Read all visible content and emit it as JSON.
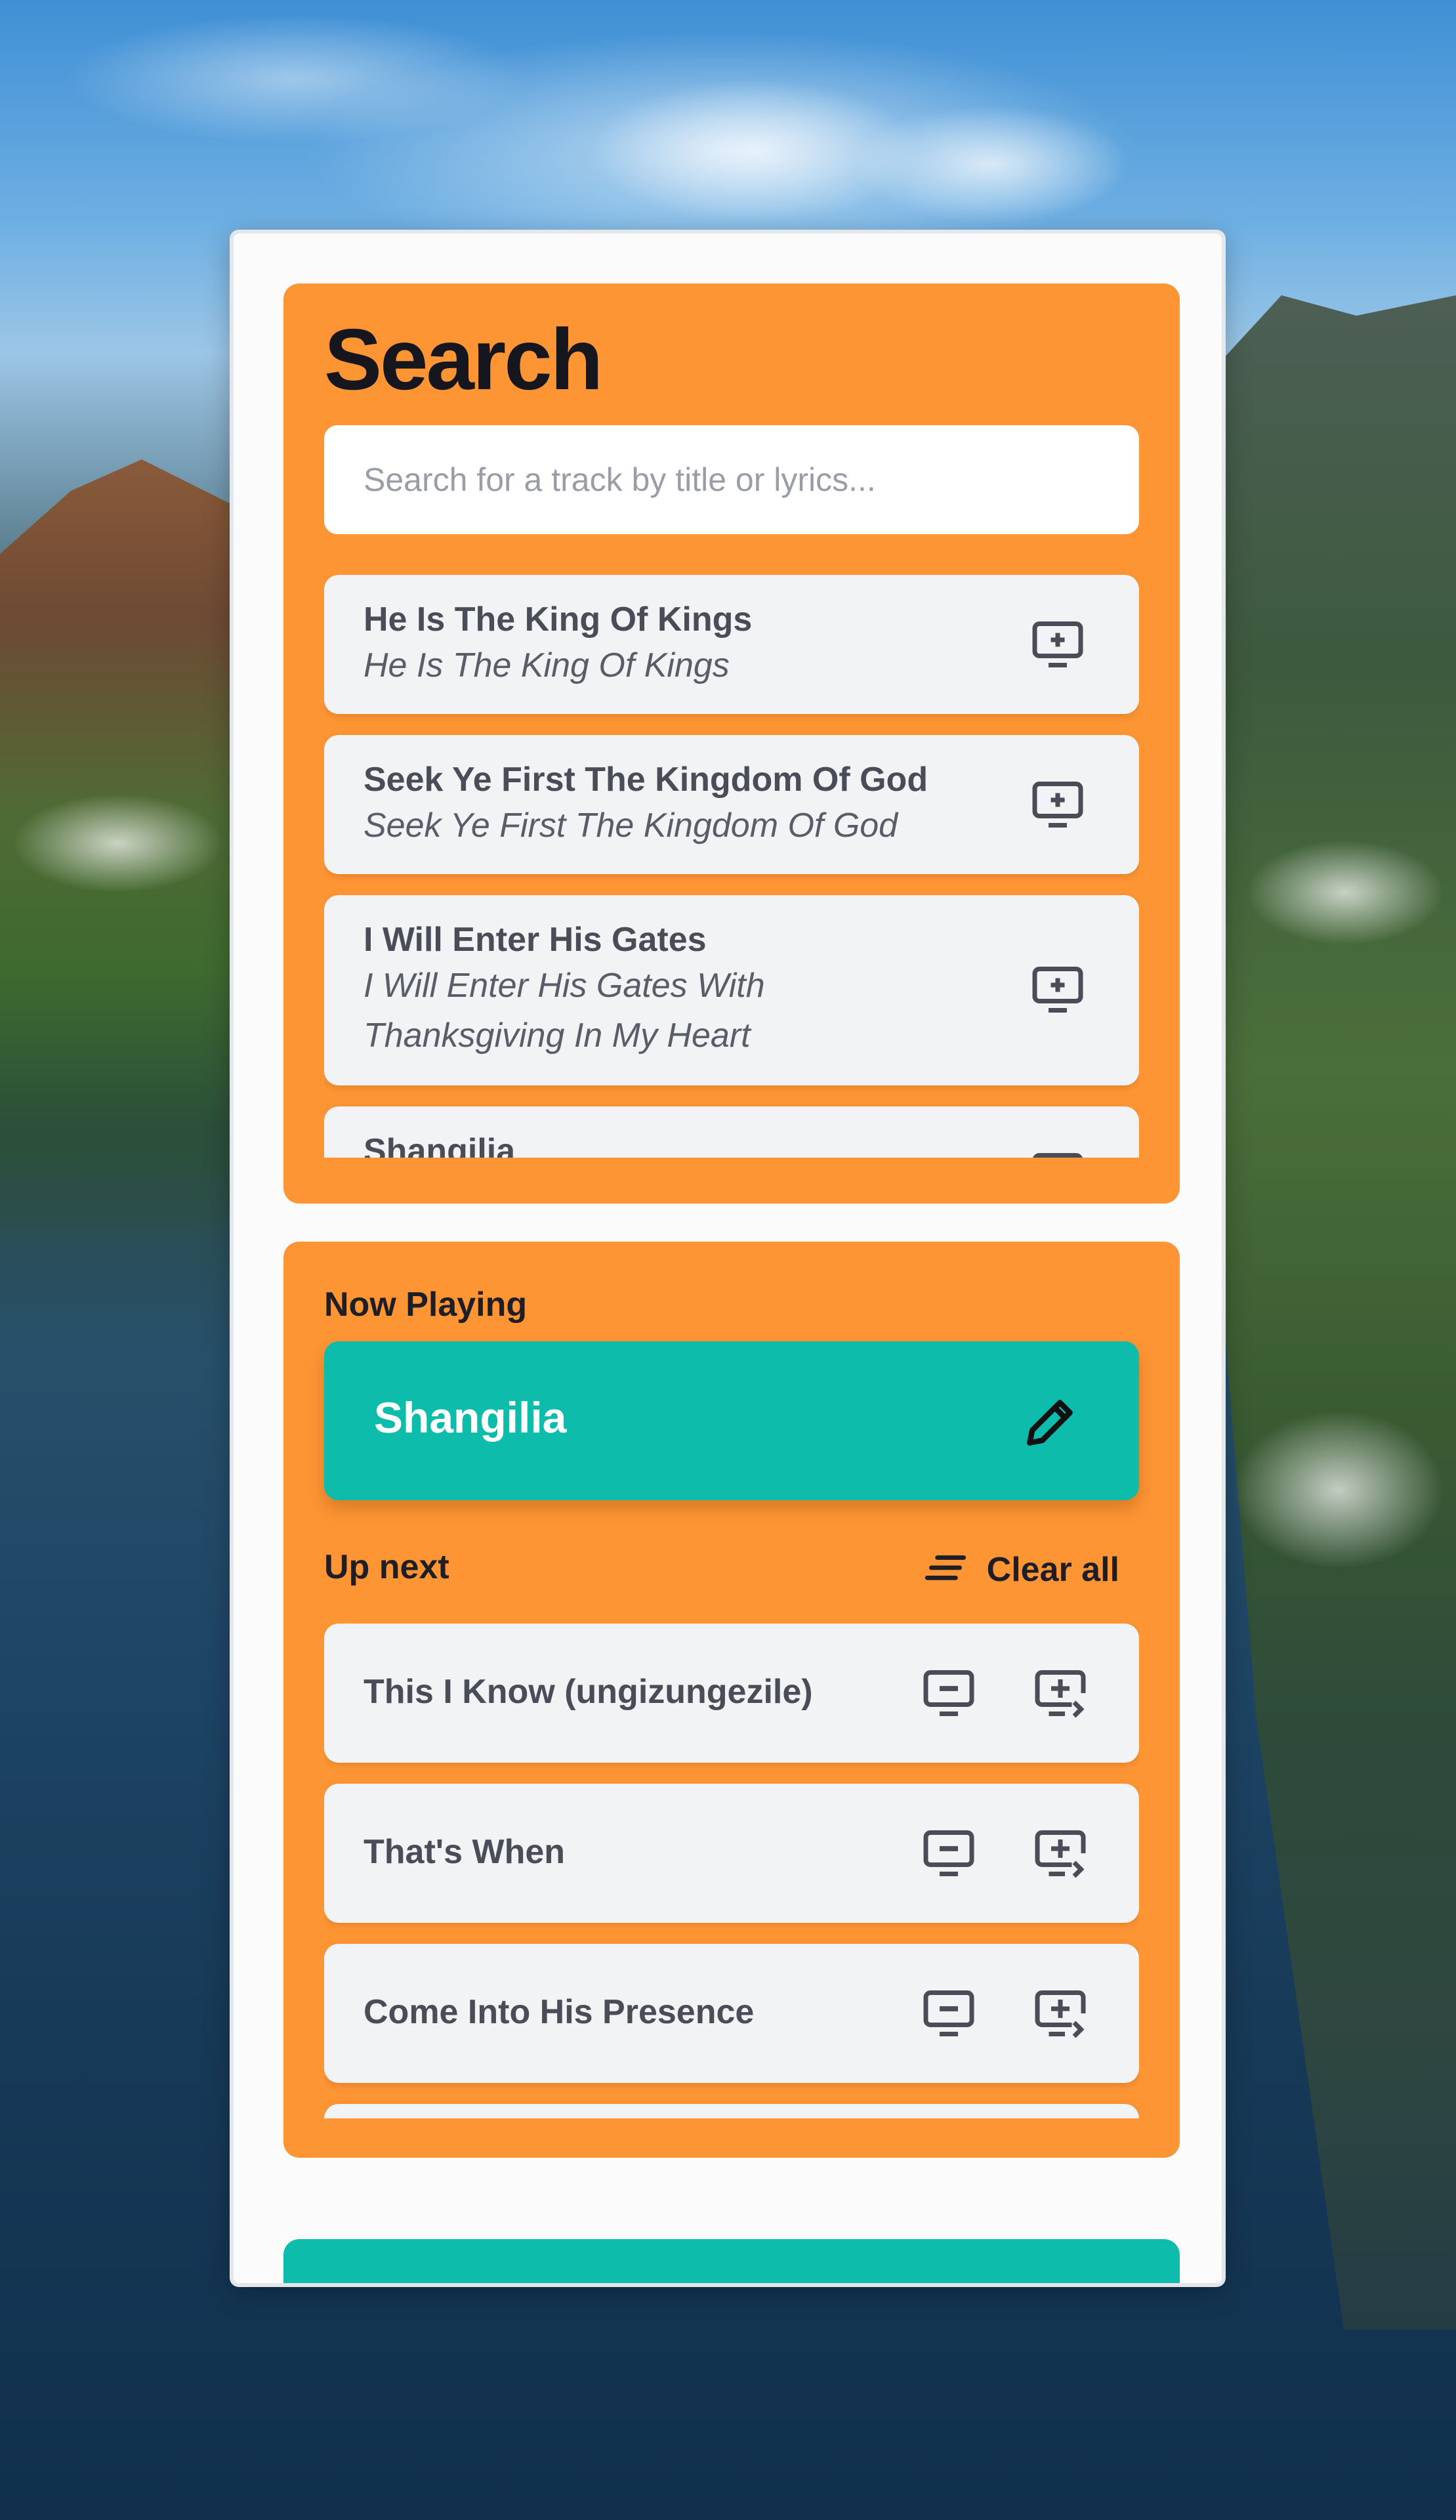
{
  "search": {
    "title": "Search",
    "placeholder": "Search for a track by title or lyrics...",
    "results": [
      {
        "title": "He Is The King Of Kings",
        "lyrics": "He Is The King Of Kings",
        "action_icon": "add-to-queue-icon"
      },
      {
        "title": "Seek Ye First The Kingdom Of God",
        "lyrics": "Seek Ye First The Kingdom Of God",
        "action_icon": "add-to-queue-icon"
      },
      {
        "title": "I Will Enter His Gates",
        "lyrics": "I Will Enter His Gates With Thanksgiving In My Heart",
        "action_icon": "add-to-queue-icon"
      },
      {
        "title": "Shangilia",
        "lyrics": "",
        "action_icon": "add-to-queue-icon"
      }
    ]
  },
  "now_playing": {
    "label": "Now Playing",
    "title": "Shangilia",
    "edit_icon": "pencil-icon"
  },
  "up_next": {
    "label": "Up next",
    "clear_all_label": "Clear all",
    "clear_icon": "clear-list-icon",
    "items": [
      {
        "title": "This I Know (ungizungezile)"
      },
      {
        "title": "That's When"
      },
      {
        "title": "Come Into His Presence"
      },
      {
        "title": ""
      }
    ]
  },
  "colors": {
    "accent_orange": "#fd9535",
    "accent_teal": "#0dbcaa",
    "card_bg": "#f2f3f5",
    "panel_bg": "#fbfbfc"
  }
}
